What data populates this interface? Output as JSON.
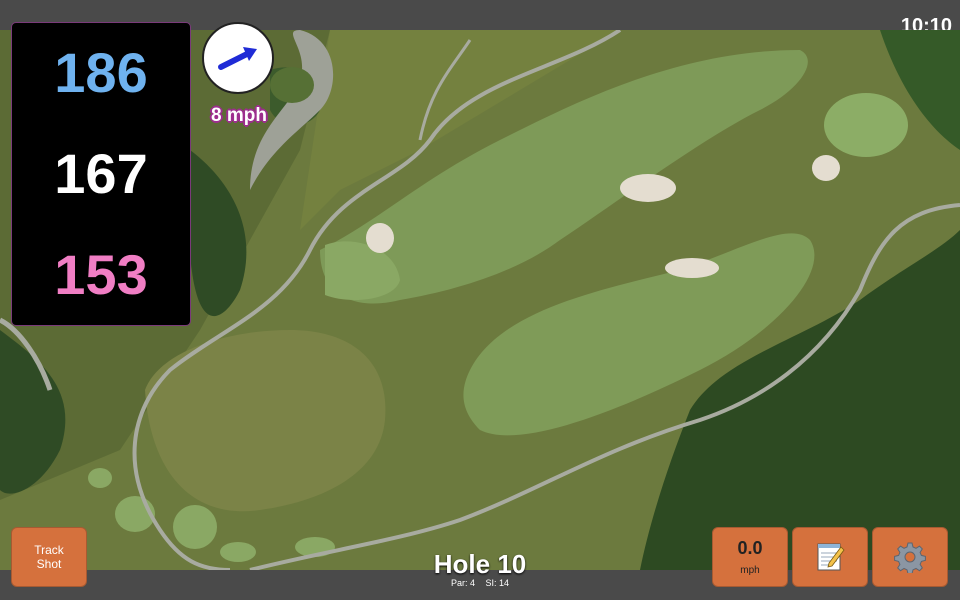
{
  "status": {
    "clock": "10:10"
  },
  "distances": {
    "back": "186",
    "middle": "167",
    "front": "153"
  },
  "wind": {
    "speed_label": "8 mph",
    "icon": "wind-direction-arrow-icon"
  },
  "hole": {
    "title": "Hole 10",
    "par": "Par: 4",
    "si": "SI: 14"
  },
  "buttons": {
    "track_shot": [
      "Track",
      "Shot"
    ],
    "speed_value": "0.0",
    "speed_unit": "mph",
    "notes_icon": "notepad-icon",
    "settings_icon": "gear-icon"
  },
  "colors": {
    "back_distance": "#6fb2ef",
    "middle_distance": "#ffffff",
    "front_distance": "#f07ec4",
    "button_orange": "#d5713d",
    "wind_arrow": "#1f2bd6"
  }
}
